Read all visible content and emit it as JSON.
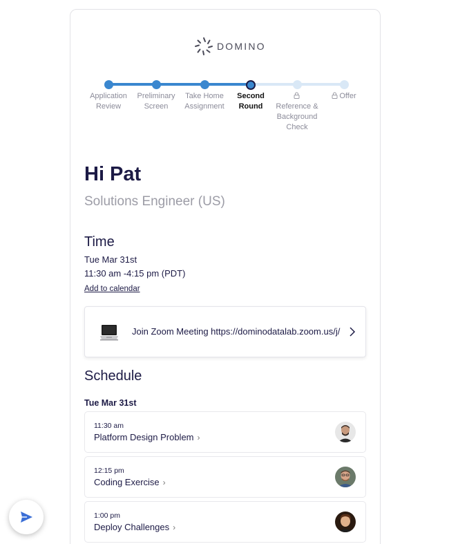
{
  "brand": {
    "name": "DOMINO"
  },
  "progress": {
    "steps": [
      {
        "label": "Application Review",
        "state": "done"
      },
      {
        "label": "Preliminary Screen",
        "state": "done"
      },
      {
        "label": "Take Home Assignment",
        "state": "done"
      },
      {
        "label": "Second Round",
        "state": "current"
      },
      {
        "label": "Reference & Background Check",
        "state": "locked"
      },
      {
        "label": "Offer",
        "state": "locked"
      }
    ],
    "colors": {
      "done": "#3a87cf",
      "todo": "#d9e8f6",
      "current_ring": "#1c1a45"
    }
  },
  "greeting": "Hi Pat",
  "role": "Solutions Engineer (US)",
  "time": {
    "title": "Time",
    "date": "Tue Mar 31st",
    "range": "11:30 am -4:15 pm (PDT)",
    "add_calendar": "Add to calendar"
  },
  "meeting": {
    "text": "Join Zoom Meeting https://dominodatalab.zoom.us/j/",
    "icon": "laptop-icon"
  },
  "schedule": {
    "title": "Schedule",
    "date": "Tue Mar 31st",
    "items": [
      {
        "time": "11:30 am",
        "title": "Platform Design Problem"
      },
      {
        "time": "12:15 pm",
        "title": "Coding Exercise"
      },
      {
        "time": "1:00 pm",
        "title": "Deploy Challenges"
      }
    ]
  }
}
